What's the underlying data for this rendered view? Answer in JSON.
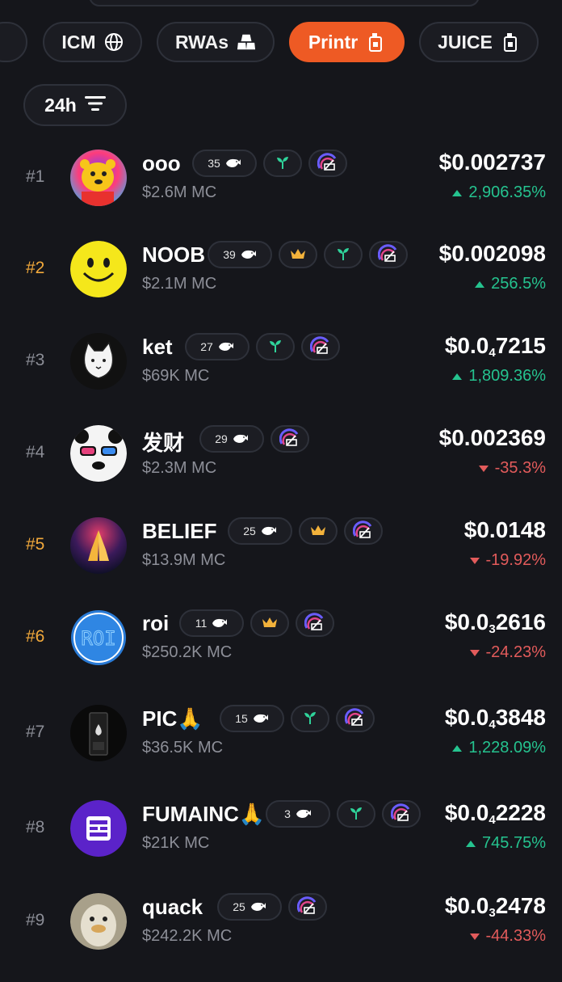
{
  "filters": [
    {
      "label": "ICM",
      "icon": "globe-icon",
      "active": false
    },
    {
      "label": "RWAs",
      "icon": "gold-bars-icon",
      "active": false
    },
    {
      "label": "Printr",
      "icon": "juice-box-icon",
      "active": true
    },
    {
      "label": "JUICE",
      "icon": "juice-box-icon",
      "active": false
    }
  ],
  "period": {
    "label": "24h",
    "icon": "sort-lines-icon"
  },
  "colors": {
    "accent": "#ee5a24",
    "up": "#25c38f",
    "down": "#e25b5b",
    "rank_gold": "#f2a93b"
  },
  "tokens": [
    {
      "rank": "#1",
      "name": "ooo",
      "mc": "$2.6M MC",
      "holders": "35",
      "crown": false,
      "sprout": true,
      "price_main": "$0.002737",
      "price_sub": "",
      "price_tail": "",
      "change": "2,906.35%",
      "dir": "up",
      "gold": false,
      "avatar": "yellow-bear-avatar"
    },
    {
      "rank": "#2",
      "name": "NOOB",
      "mc": "$2.1M MC",
      "holders": "39",
      "crown": true,
      "sprout": true,
      "price_main": "$0.002098",
      "price_sub": "",
      "price_tail": "",
      "change": "256.5%",
      "dir": "up",
      "gold": true,
      "avatar": "smiley-avatar"
    },
    {
      "rank": "#3",
      "name": "ket",
      "mc": "$69K MC",
      "holders": "27",
      "crown": false,
      "sprout": true,
      "price_main": "$0.0",
      "price_sub": "4",
      "price_tail": "7215",
      "change": "1,809.36%",
      "dir": "up",
      "gold": false,
      "avatar": "cat-avatar"
    },
    {
      "rank": "#4",
      "name": "发财",
      "mc": "$2.3M MC",
      "holders": "29",
      "crown": false,
      "sprout": false,
      "price_main": "$0.002369",
      "price_sub": "",
      "price_tail": "",
      "change": "-35.3%",
      "dir": "down",
      "gold": false,
      "avatar": "panda-avatar"
    },
    {
      "rank": "#5",
      "name": "BELIEF",
      "mc": "$13.9M MC",
      "holders": "25",
      "crown": true,
      "sprout": false,
      "price_main": "$0.0148",
      "price_sub": "",
      "price_tail": "",
      "change": "-19.92%",
      "dir": "down",
      "gold": true,
      "avatar": "praying-hands-avatar"
    },
    {
      "rank": "#6",
      "name": "roi",
      "mc": "$250.2K MC",
      "holders": "11",
      "crown": true,
      "sprout": false,
      "price_main": "$0.0",
      "price_sub": "3",
      "price_tail": "2616",
      "change": "-24.23%",
      "dir": "down",
      "gold": true,
      "avatar": "roi-text-avatar"
    },
    {
      "rank": "#7",
      "name": "PIC🙏",
      "mc": "$36.5K MC",
      "holders": "15",
      "crown": false,
      "sprout": true,
      "price_main": "$0.0",
      "price_sub": "4",
      "price_tail": "3848",
      "change": "1,228.09%",
      "dir": "up",
      "gold": false,
      "avatar": "device-avatar"
    },
    {
      "rank": "#8",
      "name": "FUMAINC🙏",
      "mc": "$21K MC",
      "holders": "3",
      "crown": false,
      "sprout": true,
      "price_main": "$0.0",
      "price_sub": "4",
      "price_tail": "2228",
      "change": "745.75%",
      "dir": "up",
      "gold": false,
      "avatar": "purple-logo-avatar"
    },
    {
      "rank": "#9",
      "name": "quack",
      "mc": "$242.2K MC",
      "holders": "25",
      "crown": false,
      "sprout": false,
      "price_main": "$0.0",
      "price_sub": "3",
      "price_tail": "2478",
      "change": "-44.33%",
      "dir": "down",
      "gold": false,
      "avatar": "duck-avatar"
    }
  ]
}
